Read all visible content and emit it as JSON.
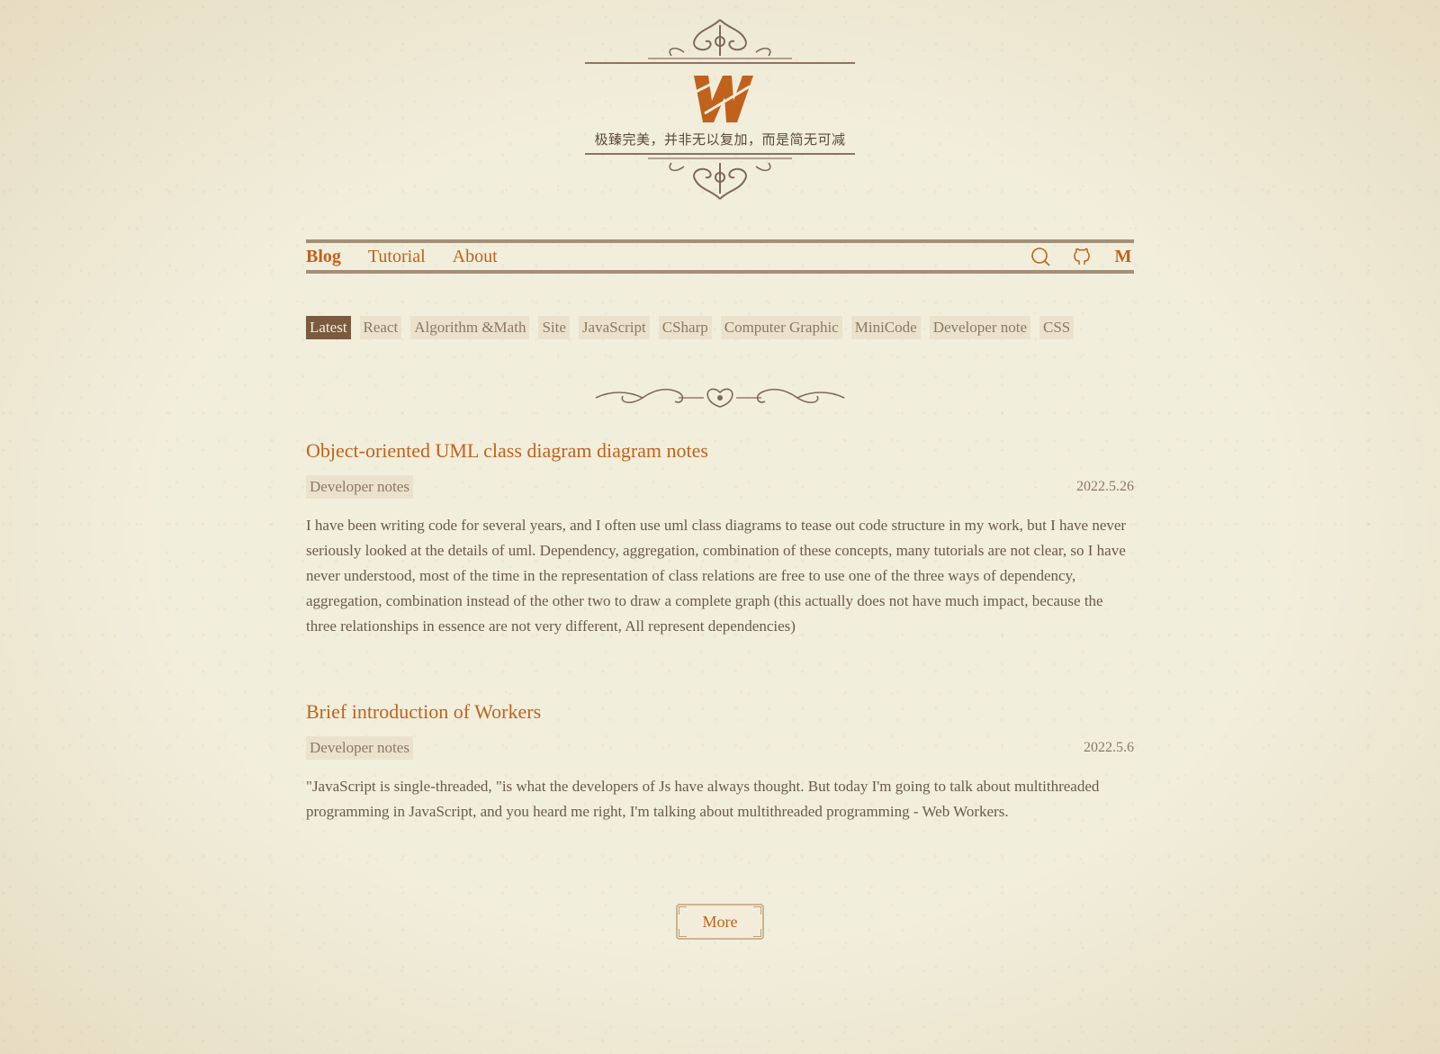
{
  "header": {
    "logo_icon": "w-logo-icon",
    "motto": "极臻完美，并非无以复加，而是简无可减"
  },
  "nav": {
    "links": [
      {
        "label": "Blog",
        "active": true
      },
      {
        "label": "Tutorial",
        "active": false
      },
      {
        "label": "About",
        "active": false
      }
    ],
    "icons": [
      "search-icon",
      "github-icon"
    ],
    "m_label": "M"
  },
  "categories": [
    {
      "label": "Latest",
      "active": true
    },
    {
      "label": "React"
    },
    {
      "label": "Algorithm &Math"
    },
    {
      "label": "Site"
    },
    {
      "label": "JavaScript"
    },
    {
      "label": "CSharp"
    },
    {
      "label": "Computer Graphic"
    },
    {
      "label": "MiniCode"
    },
    {
      "label": "Developer note"
    },
    {
      "label": "CSS"
    }
  ],
  "posts": [
    {
      "title": "Object-oriented UML class diagram diagram notes",
      "tag": "Developer notes",
      "date": "2022.5.26",
      "excerpt": "I have been writing code for several years, and I often use uml class diagrams to tease out code structure in my work, but I have never seriously looked at the details of uml. Dependency, aggregation, combination of these concepts, many tutorials are not clear, so I have never understood, most of the time in the representation of class relations are free to use one of the three ways of dependency, aggregation, combination instead of the other two to draw a complete graph (this actually does not have much impact, because the three relationships in essence are not very different, All represent dependencies)"
    },
    {
      "title": "Brief introduction of Workers",
      "tag": "Developer notes",
      "date": "2022.5.6",
      "excerpt": "\"JavaScript is single-threaded, \"is what the developers of Js have always thought. But today I'm going to talk about multithreaded programming in JavaScript, and you heard me right, I'm talking about multithreaded programming - Web Workers."
    }
  ],
  "more_label": "More",
  "colors": {
    "accent": "#c0621b",
    "rule": "#a28f78",
    "tag_bg": "#ebe2cc",
    "active_tag_bg": "#7a5b3f",
    "background": "#f2eedc"
  }
}
